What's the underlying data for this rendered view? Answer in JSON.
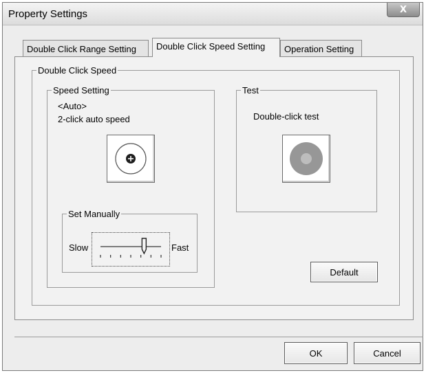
{
  "window": {
    "title": "Property Settings",
    "close_label": "X"
  },
  "tabs": [
    {
      "label": "Double Click Range Setting",
      "active": false
    },
    {
      "label": "Double Click Speed Setting",
      "active": true
    },
    {
      "label": "Operation Setting",
      "active": false
    }
  ],
  "double_click_speed": {
    "group_label": "Double Click Speed",
    "speed_setting": {
      "group_label": "Speed Setting",
      "mode": "<Auto>",
      "description": "2-click auto speed",
      "icon": "target-icon"
    },
    "set_manually": {
      "group_label": "Set Manually",
      "slow_label": "Slow",
      "fast_label": "Fast",
      "slider_position_fraction": 0.72,
      "tick_count": 7
    },
    "test": {
      "group_label": "Test",
      "description": "Double-click test",
      "icon": "test-disc-icon"
    }
  },
  "buttons": {
    "default": "Default",
    "ok": "OK",
    "cancel": "Cancel"
  }
}
